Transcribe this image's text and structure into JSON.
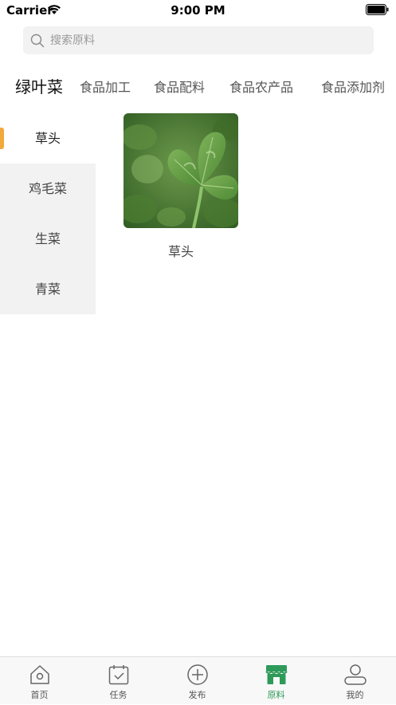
{
  "status_bar": {
    "carrier": "Carrier",
    "time": "9:00 PM"
  },
  "search": {
    "placeholder": "搜索原料"
  },
  "top_tabs": [
    {
      "label": "绿叶菜",
      "active": true
    },
    {
      "label": "食品加工",
      "active": false
    },
    {
      "label": "食品配料",
      "active": false
    },
    {
      "label": "食品农产品",
      "active": false
    },
    {
      "label": "食品添加剂",
      "active": false
    }
  ],
  "side_items": [
    {
      "label": "草头",
      "active": true
    },
    {
      "label": "鸡毛菜",
      "active": false
    },
    {
      "label": "生菜",
      "active": false
    },
    {
      "label": "青菜",
      "active": false
    }
  ],
  "products": [
    {
      "name": "草头",
      "image": "clover-leaves-photo"
    }
  ],
  "tab_bar": [
    {
      "label": "首页",
      "icon": "home-icon",
      "active": false
    },
    {
      "label": "任务",
      "icon": "calendar-check-icon",
      "active": false
    },
    {
      "label": "发布",
      "icon": "plus-circle-icon",
      "active": false
    },
    {
      "label": "原料",
      "icon": "store-icon",
      "active": true
    },
    {
      "label": "我的",
      "icon": "user-icon",
      "active": false
    }
  ],
  "colors": {
    "accent_green": "#2e9a5a",
    "indicator_orange": "#f2a93b",
    "side_bg": "#f2f2f2"
  }
}
